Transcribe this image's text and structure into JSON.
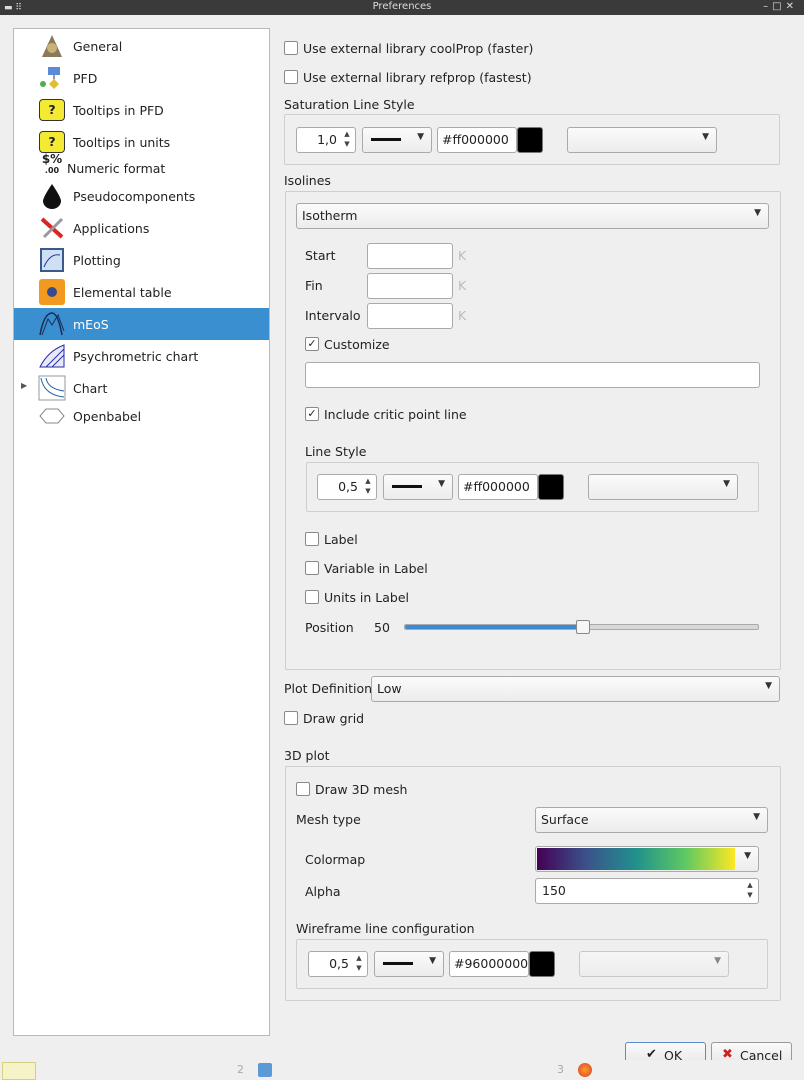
{
  "window": {
    "title": "Preferences"
  },
  "tree": {
    "items": [
      {
        "label": "General",
        "icon": "general-icon"
      },
      {
        "label": "PFD",
        "icon": "pfd-icon"
      },
      {
        "label": "Tooltips in PFD",
        "icon": "tooltip-icon"
      },
      {
        "label": "Tooltips in units",
        "icon": "tooltip-icon"
      },
      {
        "label": "Numeric format",
        "icon": "numeric-format-icon"
      },
      {
        "label": "Pseudocomponents",
        "icon": "drop-icon"
      },
      {
        "label": "Applications",
        "icon": "applications-icon"
      },
      {
        "label": "Plotting",
        "icon": "plotting-icon"
      },
      {
        "label": "Elemental table",
        "icon": "elemental-table-icon"
      },
      {
        "label": "mEoS",
        "icon": "meos-icon"
      },
      {
        "label": "Psychrometric chart",
        "icon": "psychrometric-icon"
      },
      {
        "label": "Chart",
        "icon": "chart-icon"
      },
      {
        "label": "Openbabel",
        "icon": "openbabel-icon"
      }
    ],
    "numeric_icon_text": "$%",
    "numeric_icon_sub": ".00",
    "tooltip_icon_text": "?"
  },
  "main": {
    "coolprop_label": "Use external library coolProp (faster)",
    "refprop_label": "Use external library refprop (fastest)",
    "saturation": {
      "title": "Saturation Line Style",
      "width": "1,0",
      "color": "#ff000000",
      "swatch_color": "#000000"
    },
    "isolines": {
      "title": "Isolines",
      "type": "Isotherm",
      "start_label": "Start",
      "fin_label": "Fin",
      "interval_label": "Intervalo",
      "unit": "K",
      "customize_label": "Customize",
      "critic_label": "Include critic point line",
      "line_style_title": "Line Style",
      "width": "0,5",
      "color": "#ff000000",
      "label_label": "Label",
      "variable_label": "Variable in Label",
      "units_label": "Units in Label",
      "position_label": "Position",
      "position_value": "50",
      "position_fraction": 0.5
    },
    "plot_definition_label": "Plot Definition",
    "plot_definition_value": "Low",
    "draw_grid_label": "Draw grid",
    "plot3d": {
      "title": "3D plot",
      "mesh_label": "Draw 3D mesh",
      "mesh_type_label": "Mesh type",
      "mesh_type_value": "Surface",
      "colormap_label": "Colormap",
      "alpha_label": "Alpha",
      "alpha_value": "150",
      "wireframe_title": "Wireframe line configuration",
      "width": "0,5",
      "color": "#96000000"
    }
  },
  "buttons": {
    "ok": "OK",
    "cancel": "Cancel"
  },
  "taskbar": {
    "ws2": "2",
    "ws3": "3"
  },
  "colors": {
    "selection": "#3a8fd1",
    "accent": "#3d8ad4"
  }
}
